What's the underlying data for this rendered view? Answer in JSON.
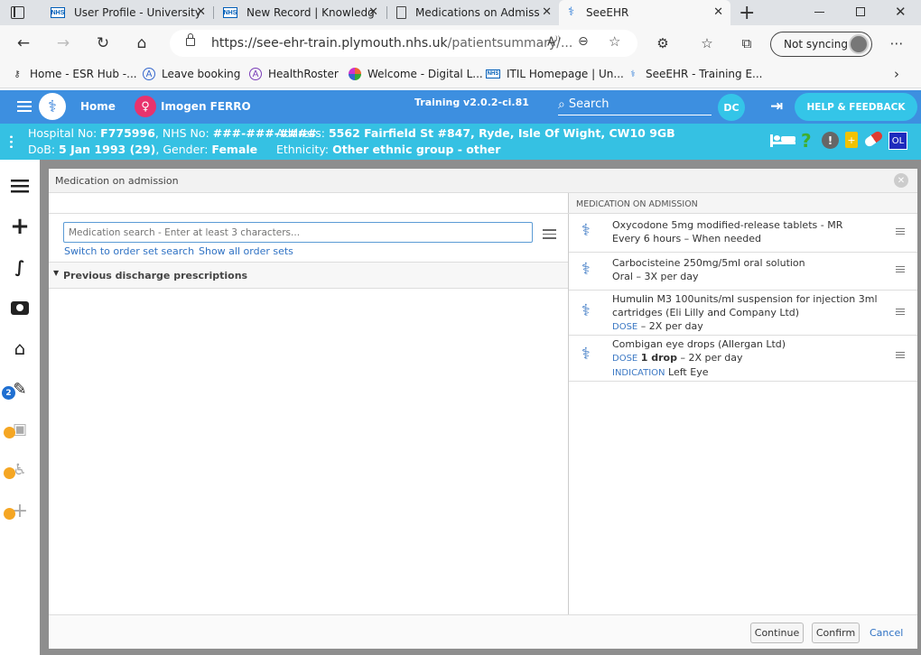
{
  "browser": {
    "tabs": [
      {
        "title": "User Profile - University"
      },
      {
        "title": "New Record | Knowledg"
      },
      {
        "title": "Medications on Admiss"
      },
      {
        "title": "SeeEHR"
      }
    ],
    "url": {
      "host": "https://see-ehr-train.plymouth.nhs.uk",
      "path": "/patientsummary/..."
    },
    "sync_label": "Not syncing",
    "bookmarks": [
      {
        "label": "Home - ESR Hub -..."
      },
      {
        "label": "Leave booking"
      },
      {
        "label": "HealthRoster"
      },
      {
        "label": "Welcome - Digital L..."
      },
      {
        "label": "ITIL Homepage | Un..."
      },
      {
        "label": "SeeEHR - Training E..."
      }
    ]
  },
  "app": {
    "home_label": "Home",
    "patient_name": "Imogen FERRO",
    "version": "Training v2.0.2-ci.81",
    "search_label": "Search",
    "user_initials": "DC",
    "help_label": "HELP & FEEDBACK"
  },
  "patient": {
    "hospital_label": "Hospital No:",
    "hospital_no": "F775996",
    "nhs_label": "NHS No:",
    "nhs_no": "###-###-####",
    "address_label": "Address:",
    "address": "5562 Fairfield St #847, Ryde, Isle Of Wight, CW10 9GB",
    "dob_label": "DoB:",
    "dob": "5 Jan 1993 (29)",
    "gender_label": "Gender:",
    "gender": "Female",
    "ethnicity_label": "Ethnicity:",
    "ethnicity": "Other ethnic group - other",
    "ol_badge": "OL"
  },
  "sidebar": {
    "badge_count": "2"
  },
  "modal": {
    "title": "Medication on admission",
    "search_placeholder": "Medication search - Enter at least 3 characters...",
    "link_order_set": "Switch to order set search",
    "link_show_all": "Show all order sets",
    "section_previous": "Previous discharge prescriptions",
    "right_header": "MEDICATION ON ADMISSION",
    "medications": [
      {
        "line1": "Oxycodone 5mg modified-release tablets - MR",
        "line2": "Every 6 hours – When needed"
      },
      {
        "line1": "Carbocisteine 250mg/5ml oral solution",
        "line2": "Oral – 3X per day"
      },
      {
        "line1": "Humulin M3 100units/ml suspension for injection 3ml",
        "line1b": "cartridges (Eli Lilly and Company Ltd)",
        "dose_label": "DOSE",
        "line2": "– 2X per day"
      },
      {
        "line1": "Combigan eye drops (Allergan Ltd)",
        "dose_label": "DOSE",
        "dose_value": "1 drop",
        "line2": "– 2X per day",
        "indication_label": "INDICATION",
        "indication_value": "Left Eye"
      }
    ],
    "continue_label": "Continue",
    "confirm_label": "Confirm",
    "cancel_label": "Cancel"
  }
}
